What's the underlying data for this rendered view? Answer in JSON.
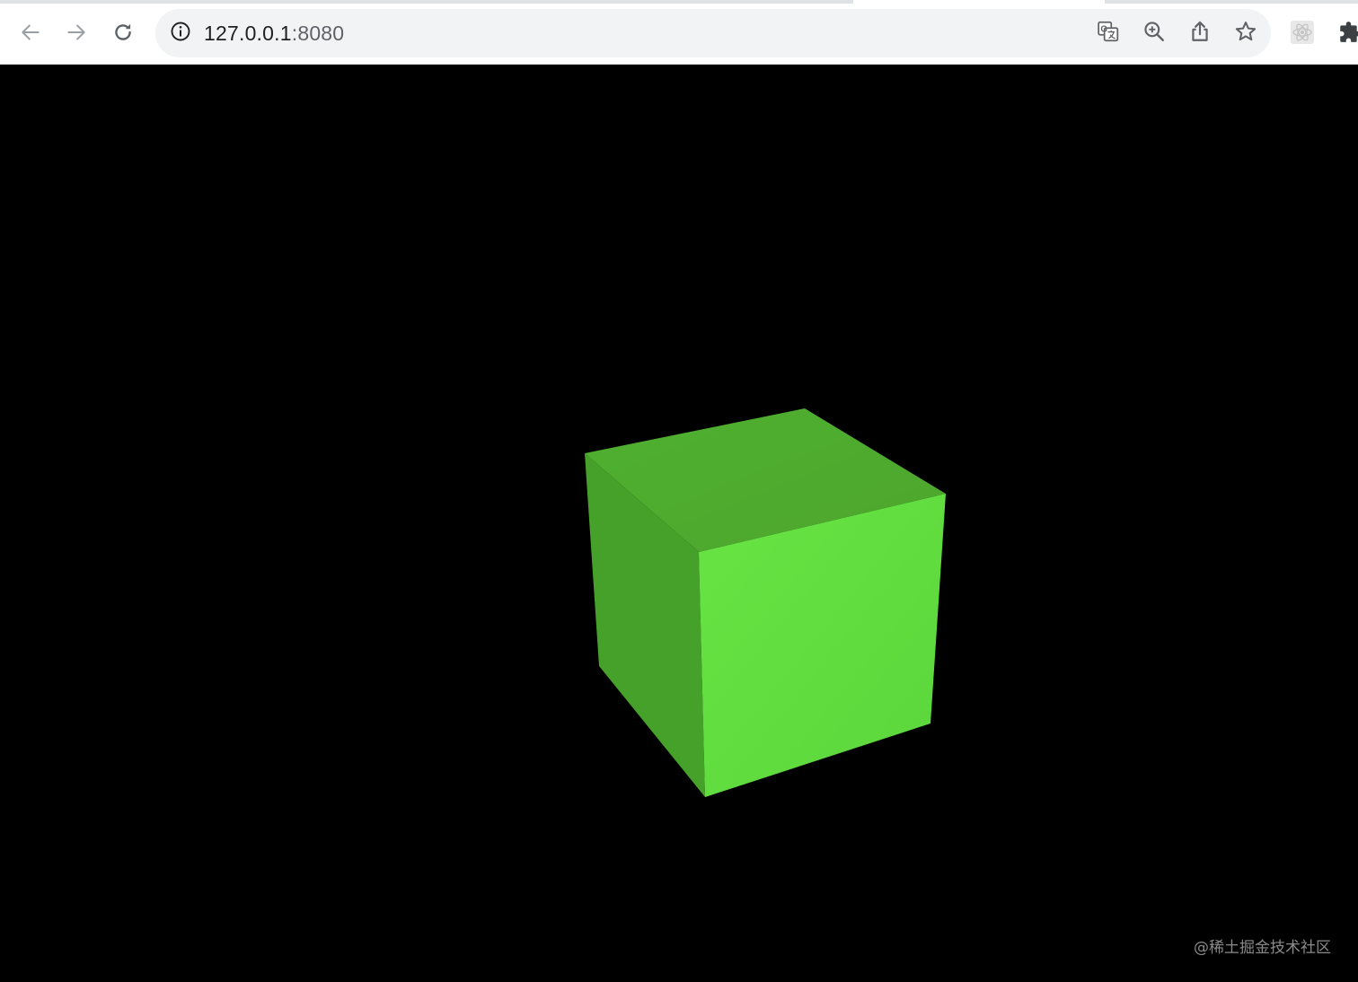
{
  "browser": {
    "url_host": "127.0.0.1",
    "url_port": ":8080",
    "icons": {
      "back": "arrow-left-icon",
      "forward": "arrow-right-icon",
      "reload": "reload-icon",
      "site_info": "info-icon",
      "translate": "translate-icon",
      "zoom": "zoom-in-icon",
      "share": "share-icon",
      "bookmark": "star-icon",
      "extension_app": "react-devtools-icon",
      "extensions": "puzzle-icon"
    }
  },
  "scene": {
    "object": "cube",
    "colors": {
      "background": "#000000",
      "top_face": "#4eaa2e",
      "left_face": "#46a12a",
      "right_face": "#64e042"
    }
  },
  "watermark": "@稀土掘金技术社区"
}
